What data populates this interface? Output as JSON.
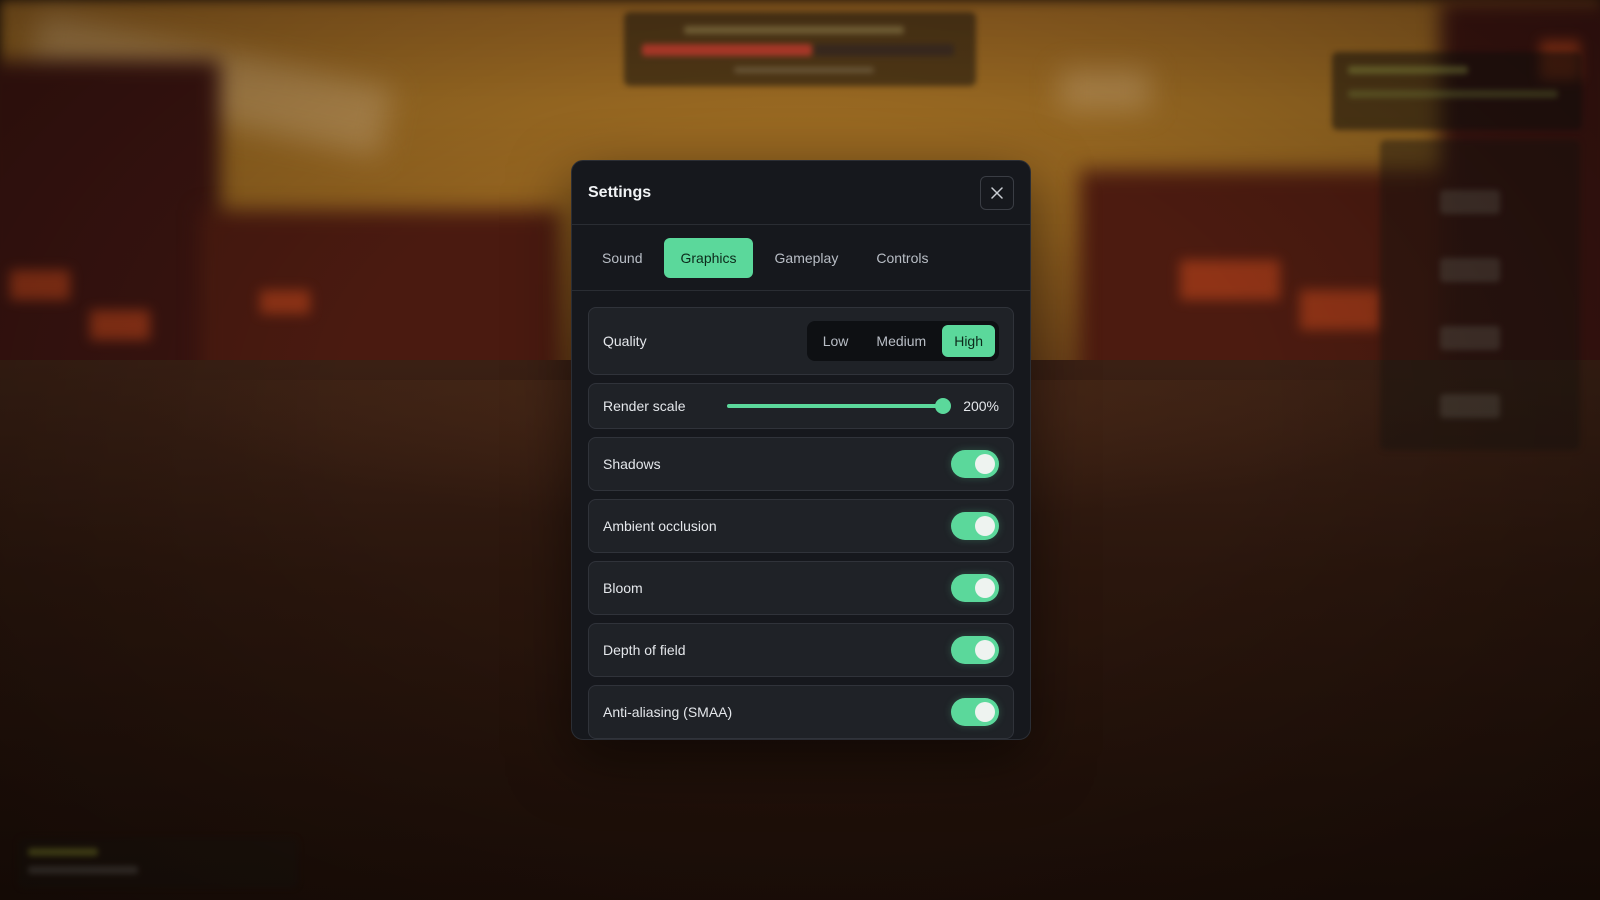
{
  "settings": {
    "title": "Settings",
    "close_icon": "close-icon",
    "tabs": [
      {
        "label": "Sound",
        "active": false
      },
      {
        "label": "Graphics",
        "active": true
      },
      {
        "label": "Gameplay",
        "active": false
      },
      {
        "label": "Controls",
        "active": false
      }
    ],
    "quality": {
      "label": "Quality",
      "options": [
        "Low",
        "Medium",
        "High"
      ],
      "selected": "High"
    },
    "render_scale": {
      "label": "Render scale",
      "value_text": "200%",
      "fill_fraction": 1.0
    },
    "toggles": [
      {
        "label": "Shadows",
        "on": true
      },
      {
        "label": "Ambient occlusion",
        "on": true
      },
      {
        "label": "Bloom",
        "on": true
      },
      {
        "label": "Depth of field",
        "on": true
      },
      {
        "label": "Anti-aliasing (SMAA)",
        "on": true
      }
    ]
  },
  "colors": {
    "accent": "#5bd89b",
    "panel": "#16181d",
    "row": "#1f2227"
  }
}
